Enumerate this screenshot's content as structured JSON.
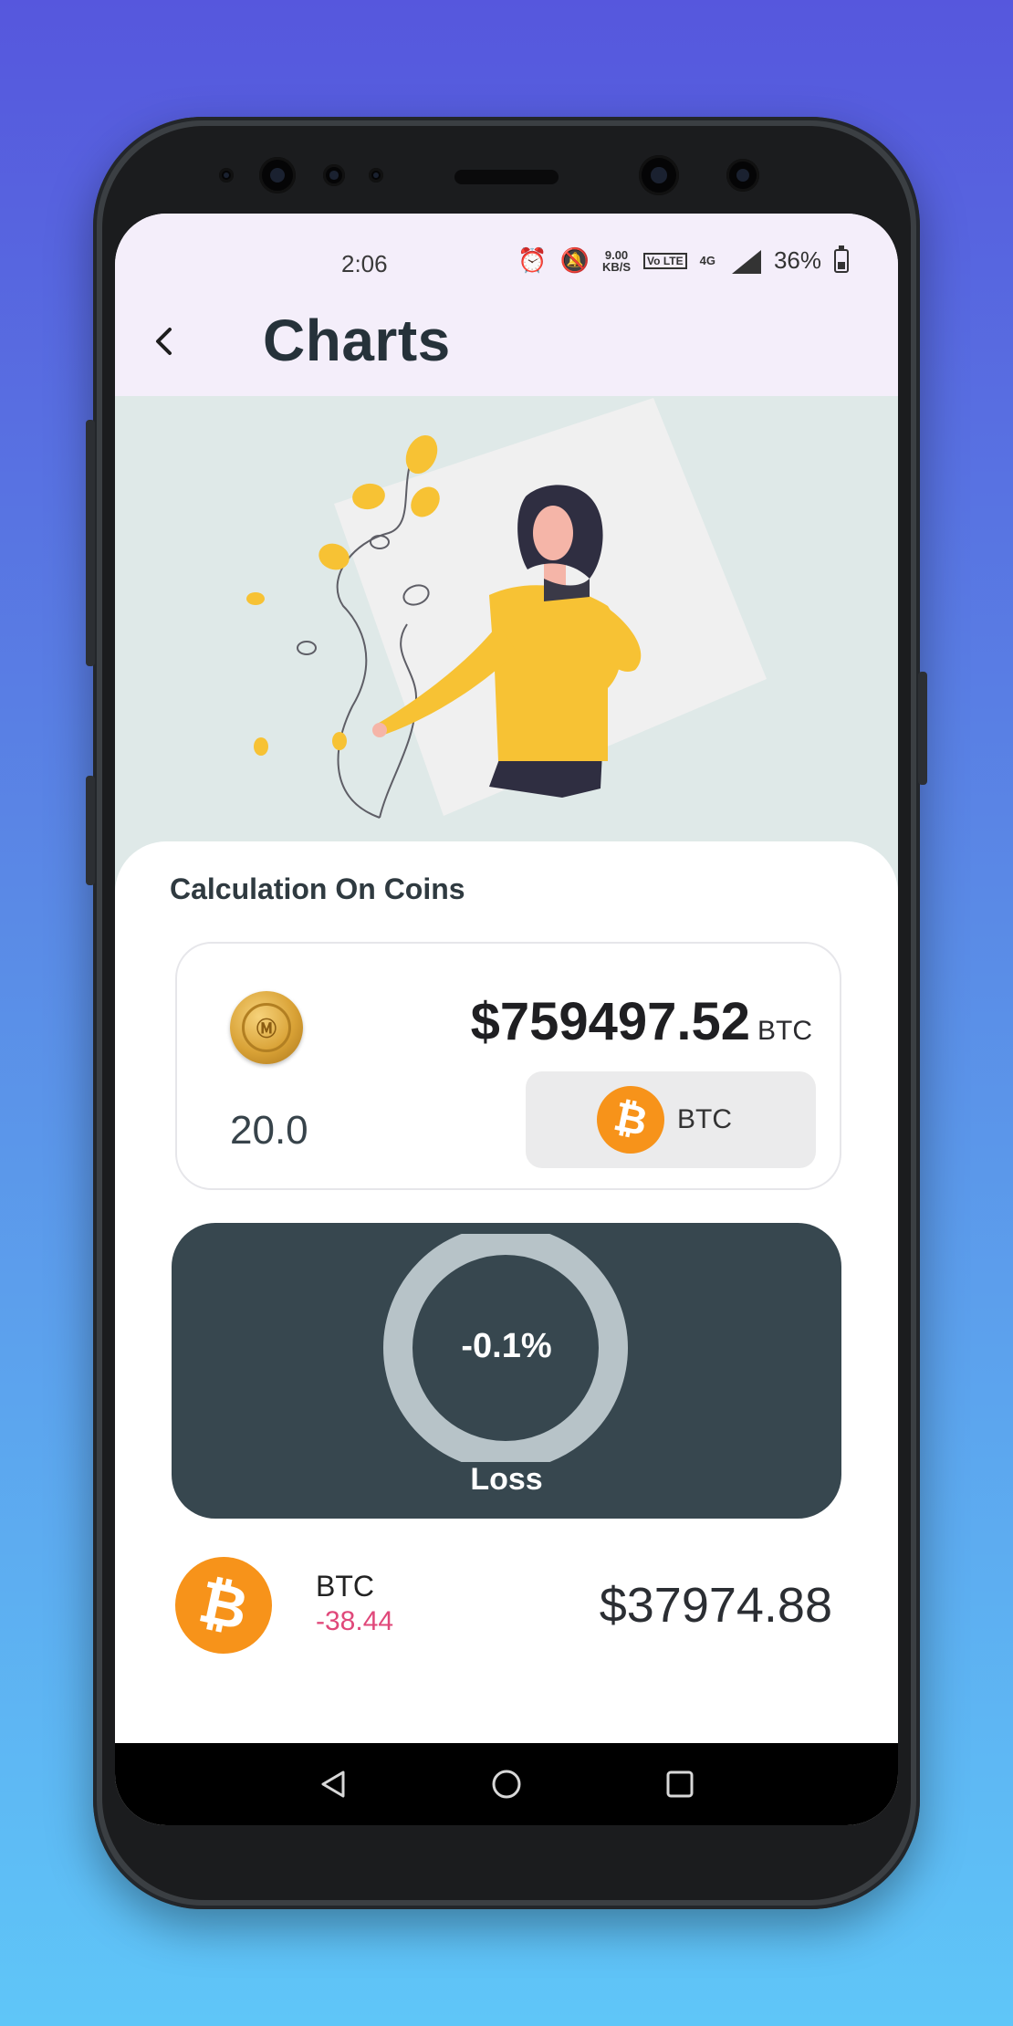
{
  "status_bar": {
    "time": "2:06",
    "speed_value": "9.00",
    "speed_unit": "KB/S",
    "lte_label": "Vo LTE",
    "network_label": "4G",
    "battery_percent": "36%"
  },
  "app_bar": {
    "title": "Charts",
    "back_icon": "chevron-left-icon"
  },
  "calculation": {
    "section_title": "Calculation On Coins",
    "amount_value": "$759497.52",
    "amount_unit": "BTC",
    "quantity": "20.0",
    "selected_coin": "BTC",
    "coin_icon": "bitcoin-icon"
  },
  "result": {
    "percent": "-0.1%",
    "label": "Loss"
  },
  "coin_list": [
    {
      "symbol": "BTC",
      "change": "-38.44",
      "price": "$37974.88"
    }
  ],
  "colors": {
    "accent_orange": "#f7931a",
    "result_card": "#37474f",
    "loss_text": "#e0487a",
    "app_bar": "#f4eefa",
    "hero_bg": "#dfe9e8"
  }
}
